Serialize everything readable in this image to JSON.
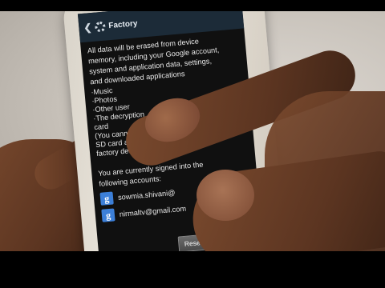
{
  "screen": {
    "header_title": "Factory",
    "body_lines": [
      "All data will be erased from device",
      "memory, including your Google account,",
      "system and application data, settings,",
      "and downloaded applications"
    ],
    "bullets": [
      "·Music",
      "·Photos",
      "·Other user",
      "·The decryption",
      "card",
      "(You cannot use encrypted files",
      "SD card after you reset your device to",
      "factory defaults.)"
    ],
    "signed_in_line1": "You are currently signed into the",
    "signed_in_line2": "following accounts:",
    "accounts": [
      {
        "email": "sowmia.shivani@",
        "icon": "google-account-icon"
      },
      {
        "email": "nirmaltv@gmail.com",
        "icon": "google-account-icon"
      }
    ],
    "reset_button_label": "Reset device"
  }
}
